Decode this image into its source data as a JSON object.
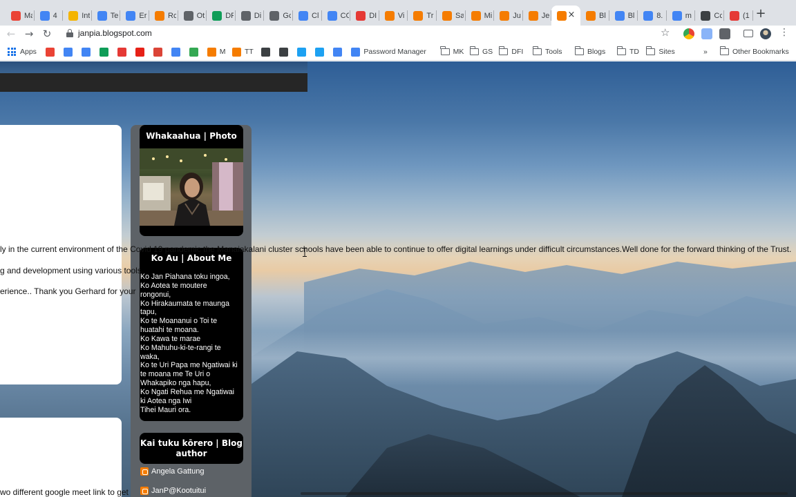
{
  "browser": {
    "tabs": [
      {
        "label": "Mail",
        "icon": "gmail-icon",
        "color": "#ea4335"
      },
      {
        "label": "4",
        "icon": "calendar-icon",
        "color": "#4285f4"
      },
      {
        "label": "Int",
        "icon": "slides-icon",
        "color": "#f4b400"
      },
      {
        "label": "Te",
        "icon": "docs-icon",
        "color": "#4285f4"
      },
      {
        "label": "Er",
        "icon": "docs-icon",
        "color": "#4285f4"
      },
      {
        "label": "Rc",
        "icon": "blogger-icon",
        "color": "#f57c00"
      },
      {
        "label": "Ot",
        "icon": "calculator-icon",
        "color": "#5f6368"
      },
      {
        "label": "DF",
        "icon": "sheets-icon",
        "color": "#0f9d58"
      },
      {
        "label": "Di",
        "icon": "translate-icon",
        "color": "#5f6368"
      },
      {
        "label": "Gc",
        "icon": "clock-icon",
        "color": "#5f6368"
      },
      {
        "label": "Cl",
        "icon": "google-icon",
        "color": "#4285f4"
      },
      {
        "label": "CC",
        "icon": "docs-icon",
        "color": "#4285f4"
      },
      {
        "label": "DI",
        "icon": "tt-icon",
        "color": "#e53935"
      },
      {
        "label": "Vi",
        "icon": "blogger-icon",
        "color": "#f57c00"
      },
      {
        "label": "Tr",
        "icon": "blogger-icon",
        "color": "#f57c00"
      },
      {
        "label": "Sa",
        "icon": "blogger-icon",
        "color": "#f57c00"
      },
      {
        "label": "Mi",
        "icon": "blogger-icon",
        "color": "#f57c00"
      },
      {
        "label": "Ju",
        "icon": "blogger-icon",
        "color": "#f57c00"
      },
      {
        "label": "Je",
        "icon": "blogger-icon",
        "color": "#f57c00"
      },
      {
        "label": "",
        "icon": "blogger-icon",
        "color": "#f57c00",
        "active": true
      },
      {
        "label": "Bl",
        "icon": "blogger-icon",
        "color": "#f57c00"
      },
      {
        "label": "Bl",
        "icon": "docs-icon",
        "color": "#4285f4"
      },
      {
        "label": "8.",
        "icon": "docs-icon",
        "color": "#4285f4"
      },
      {
        "label": "m",
        "icon": "google-icon",
        "color": "#4285f4"
      },
      {
        "label": "Cc",
        "icon": "book-icon",
        "color": "#3c4043"
      },
      {
        "label": "(1",
        "icon": "swirl-icon",
        "color": "#e53935"
      }
    ],
    "address": "janpia.blogspot.com",
    "bookmarks": [
      {
        "label": "Apps",
        "type": "apps"
      },
      {
        "label": "",
        "type": "icon",
        "color": "#ea4335"
      },
      {
        "label": "",
        "type": "icon",
        "color": "#4285f4"
      },
      {
        "label": "",
        "type": "icon",
        "color": "#4285f4"
      },
      {
        "label": "",
        "type": "icon",
        "color": "#0f9d58"
      },
      {
        "label": "",
        "type": "icon",
        "color": "#e53935"
      },
      {
        "label": "",
        "type": "icon",
        "color": "#e62117"
      },
      {
        "label": "",
        "type": "icon",
        "color": "#db4437"
      },
      {
        "label": "",
        "type": "icon",
        "color": "#4285f4"
      },
      {
        "label": "",
        "type": "icon",
        "color": "#34a853"
      },
      {
        "label": "M",
        "type": "icon",
        "color": "#f57c00"
      },
      {
        "label": "TT",
        "type": "icon",
        "color": "#f57c00"
      },
      {
        "label": "",
        "type": "icon",
        "color": "#3c4043"
      },
      {
        "label": "",
        "type": "icon",
        "color": "#3c4043"
      },
      {
        "label": "",
        "type": "icon",
        "color": "#1da1f2"
      },
      {
        "label": "",
        "type": "icon",
        "color": "#1da1f2"
      },
      {
        "label": "",
        "type": "icon",
        "color": "#4285f4"
      },
      {
        "label": "Password Manager",
        "type": "icon",
        "color": "#4285f4"
      },
      {
        "label": "MK",
        "type": "folder"
      },
      {
        "label": "GS",
        "type": "folder"
      },
      {
        "label": "DFI",
        "type": "folder"
      },
      {
        "label": "Tools",
        "type": "folder"
      },
      {
        "label": "Blogs",
        "type": "folder"
      },
      {
        "label": "TD",
        "type": "folder"
      },
      {
        "label": "Sites",
        "type": "folder"
      }
    ],
    "overflow": "»",
    "other_bookmarks": "Other Bookmarks"
  },
  "blog": {
    "photo_widget_title": "Whakaahua | Photo",
    "about_widget_title": "Ko Au | About Me",
    "about_lines": [
      "Ko Jan Piahana toku ingoa,",
      "Ko Aotea te moutere",
      "rongonui,",
      "Ko Hirakaumata te maunga",
      "tapu,",
      "Ko te Moananui o Toi te",
      "huatahi te moana.",
      "Ko Kawa te marae",
      "Ko Mahuhu-ki-te-rangi te",
      "waka,",
      "Ko te Uri Papa me Ngatiwai ki",
      "te moana me Te Uri o",
      "Whakapiko nga hapu,",
      "Ko Ngati Rehua me Ngatiwai",
      "ki Aotea nga Iwi",
      "Tihei Mauri ora."
    ],
    "authors_widget_title": "Kai tuku kōrero | Blog author",
    "authors": [
      "Angela Gattung",
      "JanP@Kootuitui"
    ],
    "comment_lines": [
      "ly in the current environment of the Covid 19 pandemic the Manaiakalani cluster schools have been able to continue to offer digital learnings  under difficult circumstances.Well done for the forward thinking of the Trust.",
      "g and development using various tools",
      "erience.. Thank you  Gerhard for your",
      "wo different google meet link to get"
    ]
  }
}
